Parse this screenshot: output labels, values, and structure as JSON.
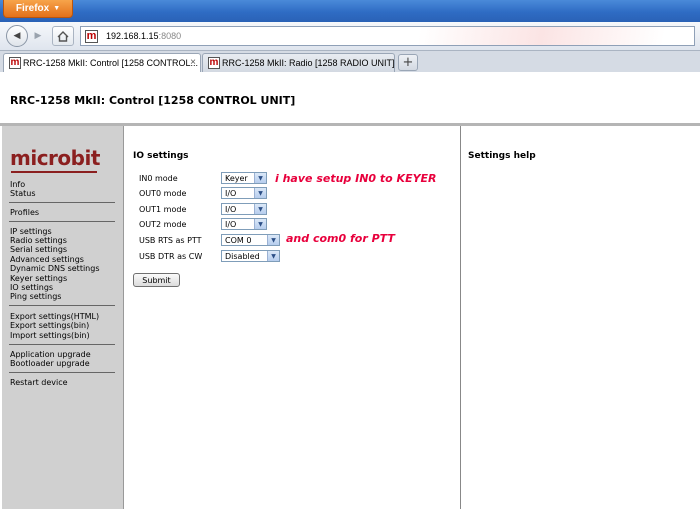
{
  "browser": {
    "app_button": "Firefox",
    "url_host": "192.168.1.15",
    "url_port": ":8080",
    "tabs": [
      {
        "label": "RRC-1258 MkII: Control [1258 CONTROL..."
      },
      {
        "label": "RRC-1258 MkII: Radio [1258 RADIO UNIT]"
      }
    ],
    "close_glyph": "×",
    "new_tab_glyph": "+",
    "back_glyph": "◀",
    "forward_glyph": "▶",
    "favicon_letter": "m",
    "icons": [
      "back-icon",
      "forward-icon",
      "home-icon",
      "favicon-icon",
      "close-icon",
      "plus-icon",
      "dropdown-arrow-icon"
    ]
  },
  "page": {
    "title": "RRC-1258 MkII: Control [1258 CONTROL UNIT]"
  },
  "sidebar": {
    "logo": "microbit",
    "groups": [
      [
        "Info",
        "Status"
      ],
      [
        "Profiles"
      ],
      [
        "IP settings",
        "Radio settings",
        "Serial settings",
        "Advanced settings",
        "Dynamic DNS settings",
        "Keyer settings",
        "IO settings",
        "Ping settings"
      ],
      [
        "Export settings(HTML)",
        "Export settings(bin)",
        "Import settings(bin)"
      ],
      [
        "Application upgrade",
        "Bootloader upgrade"
      ],
      [
        "Restart device"
      ]
    ]
  },
  "main": {
    "heading": "IO settings",
    "rows": [
      {
        "label": "IN0 mode",
        "value": "Keyer"
      },
      {
        "label": "OUT0 mode",
        "value": "I/O"
      },
      {
        "label": "OUT1 mode",
        "value": "I/O"
      },
      {
        "label": "OUT2 mode",
        "value": "I/O"
      },
      {
        "label": "USB RTS as PTT",
        "value": "COM 0"
      },
      {
        "label": "USB DTR as CW",
        "value": "Disabled"
      }
    ],
    "submit_label": "Submit",
    "annotations": [
      "i have setup IN0 to KEYER",
      "and com0 for PTT"
    ],
    "annotation_color": "#e8003c"
  },
  "help": {
    "heading": "Settings help"
  },
  "colors": {
    "brand": "#8b1f1f",
    "sidebar_bg": "#d0d0d0",
    "firefox_button": "#e3701a",
    "titlebar": "#2f6cc4"
  }
}
